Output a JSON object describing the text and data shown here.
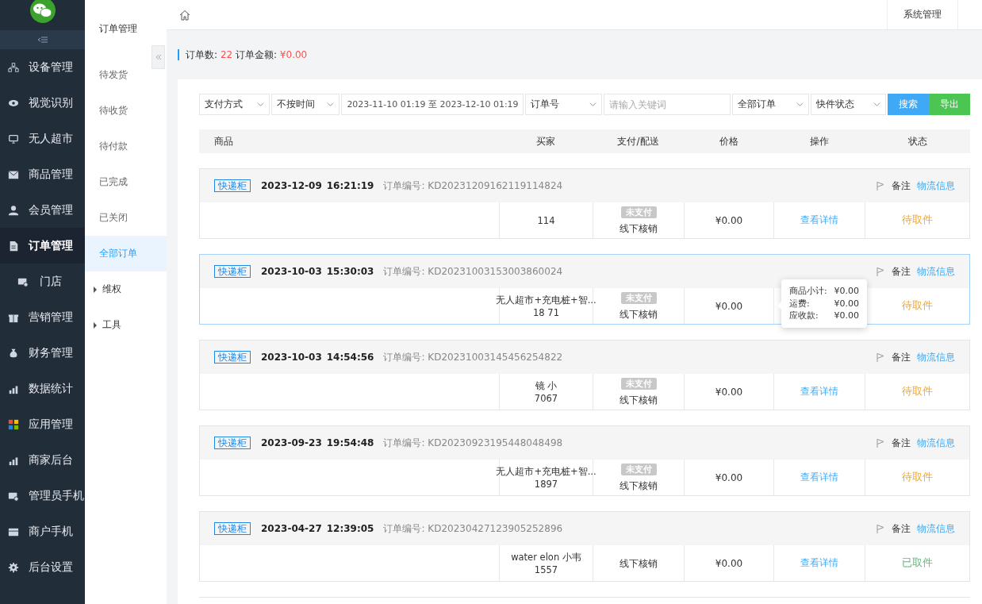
{
  "topbar": {
    "menu": [
      "系统管理"
    ]
  },
  "sidebar": {
    "items": [
      {
        "label": "设备管理",
        "kind": "main",
        "selected": false
      },
      {
        "label": "视觉识别",
        "kind": "main",
        "selected": false
      },
      {
        "label": "无人超市",
        "kind": "main",
        "selected": false
      },
      {
        "label": "商品管理",
        "kind": "main",
        "selected": false
      },
      {
        "label": "会员管理",
        "kind": "main",
        "selected": false
      },
      {
        "label": "订单管理",
        "kind": "main",
        "selected": true
      },
      {
        "label": "门店",
        "kind": "sub",
        "selected": false
      },
      {
        "label": "营销管理",
        "kind": "main",
        "selected": false
      },
      {
        "label": "财务管理",
        "kind": "main",
        "selected": false
      },
      {
        "label": "数据统计",
        "kind": "main",
        "selected": false
      },
      {
        "label": "应用管理",
        "kind": "main",
        "selected": false
      },
      {
        "label": "商家后台",
        "kind": "main",
        "selected": false
      },
      {
        "label": "管理员手机",
        "kind": "main",
        "selected": false
      },
      {
        "label": "商户手机",
        "kind": "main",
        "selected": false
      },
      {
        "label": "后台设置",
        "kind": "main",
        "selected": false
      }
    ]
  },
  "subnav": {
    "title": "订单管理",
    "items": [
      {
        "label": "待发货",
        "kind": "link",
        "selected": false
      },
      {
        "label": "待收货",
        "kind": "link",
        "selected": false
      },
      {
        "label": "待付款",
        "kind": "link",
        "selected": false
      },
      {
        "label": "已完成",
        "kind": "link",
        "selected": false
      },
      {
        "label": "已关闭",
        "kind": "link",
        "selected": false
      },
      {
        "label": "全部订单",
        "kind": "link",
        "selected": true
      },
      {
        "label": "维权",
        "kind": "group",
        "expanded": false
      },
      {
        "label": "工具",
        "kind": "group",
        "expanded": false
      }
    ]
  },
  "summary": {
    "count_label": "订单数:",
    "count": "22",
    "amount_label": "订单金额:",
    "amount": "¥0.00"
  },
  "filters": [
    {
      "kind": "select",
      "value": "支付方式"
    },
    {
      "kind": "select",
      "value": "不按时间"
    },
    {
      "kind": "range",
      "value": "2023-11-10 01:19 至 2023-12-10 01:19"
    },
    {
      "kind": "select",
      "value": "订单号"
    },
    {
      "kind": "input",
      "placeholder": "请输入关键词"
    },
    {
      "kind": "select",
      "value": "全部订单"
    },
    {
      "kind": "select",
      "value": "快件状态"
    }
  ],
  "buttons": [
    {
      "label": "搜索",
      "kind": "primary"
    },
    {
      "label": "导出",
      "kind": "success"
    }
  ],
  "table": {
    "columns": [
      "商品",
      "买家",
      "支付/配送",
      "价格",
      "操作",
      "状态"
    ]
  },
  "orders": [
    {
      "tag": "快递柜",
      "date": "2023-12-09",
      "time": "16:21:19",
      "order_no_label": "订单编号:",
      "order_no": "KD20231209162119114824",
      "note": "备注",
      "logistics": "物流信息",
      "buyer": [
        "114"
      ],
      "pay_badge": "未支付",
      "delivery": "线下核销",
      "price": "¥0.00",
      "detail": "查看详情",
      "status": "待取件",
      "color": "#f5a623",
      "selected": false
    },
    {
      "tag": "快递柜",
      "date": "2023-10-03",
      "time": "15:30:03",
      "order_no_label": "订单编号:",
      "order_no": "KD20231003153003860024",
      "note": "备注",
      "logistics": "物流信息",
      "buyer": [
        "无人超市+充电桩+智...",
        "18   71"
      ],
      "pay_badge": "未支付",
      "delivery": "线下核销",
      "price": "¥0.00",
      "status": "待取件",
      "color": "#f5a623",
      "selected": true,
      "tooltip": [
        {
          "label": "商品小计:",
          "value": "¥0.00"
        },
        {
          "label": "运费:",
          "value": "¥0.00"
        },
        {
          "label": "应收款:",
          "value": "¥0.00"
        }
      ]
    },
    {
      "tag": "快递柜",
      "date": "2023-10-03",
      "time": "14:54:56",
      "order_no_label": "订单编号:",
      "order_no": "KD20231003145456254822",
      "note": "备注",
      "logistics": "物流信息",
      "buyer": [
        "镜 小",
        "7067"
      ],
      "pay_badge": "未支付",
      "delivery": "线下核销",
      "price": "¥0.00",
      "detail": "查看详情",
      "status": "待取件",
      "color": "#f5a623",
      "selected": false
    },
    {
      "tag": "快递柜",
      "date": "2023-09-23",
      "time": "19:54:48",
      "order_no_label": "订单编号:",
      "order_no": "KD20230923195448048498",
      "note": "备注",
      "logistics": "物流信息",
      "buyer": [
        "无人超市+充电桩+智...",
        "1897"
      ],
      "pay_badge": "未支付",
      "delivery": "线下核销",
      "price": "¥0.00",
      "detail": "查看详情",
      "status": "待取件",
      "color": "#f5a623",
      "selected": false
    },
    {
      "tag": "快递柜",
      "date": "2023-04-27",
      "time": "12:39:05",
      "order_no_label": "订单编号:",
      "order_no": "KD20230427123905252896",
      "note": "备注",
      "logistics": "物流信息",
      "buyer": [
        "water elon 小韦",
        "1557"
      ],
      "delivery": "线下核销",
      "price": "¥0.00",
      "detail": "查看详情",
      "status": "已取件",
      "color": "#5fb878",
      "selected": false
    }
  ]
}
